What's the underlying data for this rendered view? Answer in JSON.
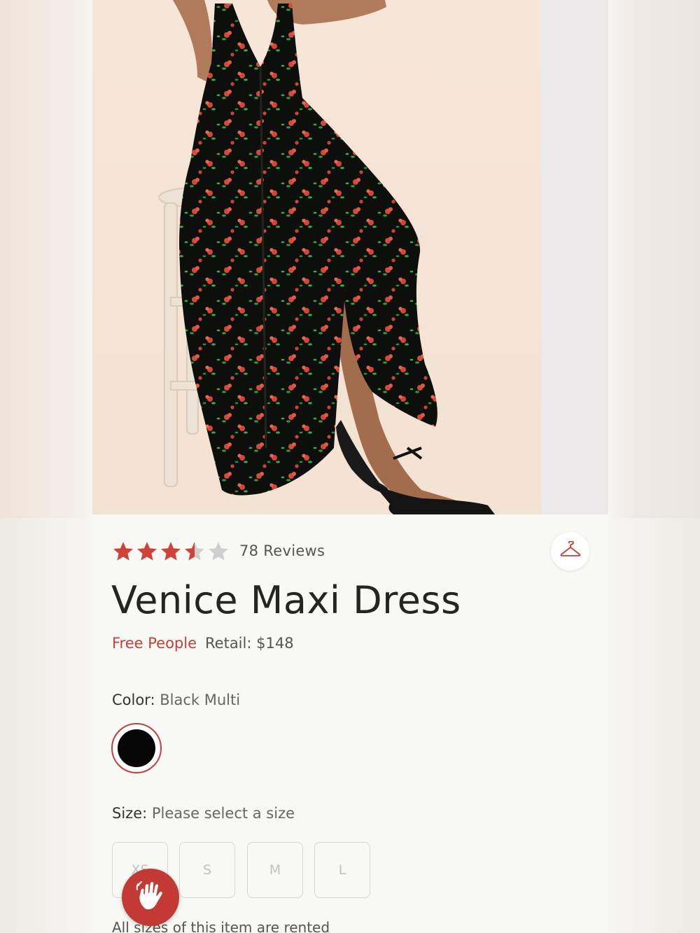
{
  "product": {
    "rating": 3.5,
    "rating_max": 5,
    "reviews_label": "78 Reviews",
    "title": "Venice Maxi Dress",
    "brand": "Free People",
    "retail": "Retail: $148"
  },
  "color": {
    "label": "Color:",
    "value": "Black Multi",
    "swatch_hex": "#050505"
  },
  "size": {
    "label": "Size:",
    "value": "Please select a size",
    "options": [
      "XS",
      "S",
      "M",
      "L"
    ]
  },
  "availability_note": "All sizes of this item are rented",
  "theme": {
    "accent": "#c0403a",
    "star_filled": "#d0413a",
    "star_empty": "#cfcfcf"
  },
  "icons": {
    "save": "hanger-icon",
    "help": "waving-hand-icon"
  }
}
